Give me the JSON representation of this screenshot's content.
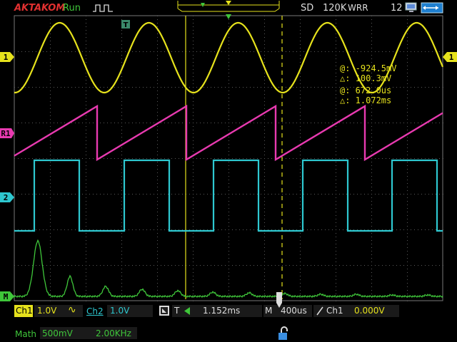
{
  "brand": "AKTAKOM",
  "run_state": "Run",
  "acq_mode": "SD",
  "mem_depth": "120K",
  "acq_type": "WRR",
  "battery_level": "12",
  "channel_markers": {
    "ch1": "1",
    "ref1": "R1",
    "ch2": "2",
    "math": "M"
  },
  "trigger_marker": "T",
  "cursor_readout": {
    "v_at": "@: -924.5mV",
    "v_delta": "△: 100.3mV",
    "t_at": "@: 672.0us",
    "t_delta": "△: 1.072ms"
  },
  "bottom_bar": {
    "ch1_label": "Ch1",
    "ch1_scale": "1.0V",
    "ch1_coupling": "∿",
    "ch2_label": "Ch2",
    "ch2_scale": "1.0V",
    "trigger_letter": "T",
    "trigger_delay": "1.152ms",
    "timebase_letter": "M",
    "timebase": "400us",
    "trigger_source": "Ch1",
    "trigger_level": "0.000V",
    "math_label": "Math",
    "math_scale": "500mV",
    "math_freq": "2.00KHz"
  },
  "colors": {
    "ch1": "#e6e21c",
    "ch2": "#2ec8d0",
    "ref": "#e83ab0",
    "math": "#3fc63a",
    "grid": "#5a5a5a",
    "cursor": "#e6e21c"
  }
}
